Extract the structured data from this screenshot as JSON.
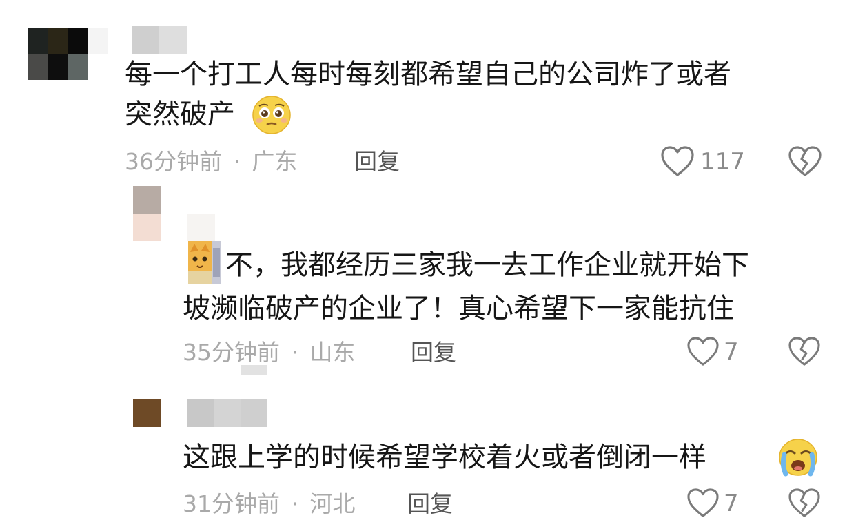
{
  "comments": [
    {
      "text_line1": "每一个打工人每时每刻都希望自己的公司炸了或者",
      "text_line2": "突然破产",
      "emoji": "pleading-face-emoji",
      "time": "36分钟前",
      "location": "广东",
      "reply_label": "回复",
      "likes": "117"
    },
    {
      "text_line1": "不，我都经历三家我一去工作企业就开始下",
      "text_line2": "坡濒临破产的企业了！真心希望下一家能抗住",
      "time": "35分钟前",
      "location": "山东",
      "reply_label": "回复",
      "likes": "7"
    },
    {
      "text_line1": "这跟上学的时候希望学校着火或者倒闭一样",
      "emoji": "loudly-crying-face-emoji",
      "time": "31分钟前",
      "location": "河北",
      "reply_label": "回复",
      "likes": "7"
    }
  ],
  "separator": "·",
  "icons": {
    "like": "heart-outline-icon",
    "dislike": "broken-heart-icon"
  },
  "colors": {
    "text": "#161616",
    "meta": "#a9a9a9",
    "reply": "#555555",
    "icon": "#7a7a7a"
  }
}
